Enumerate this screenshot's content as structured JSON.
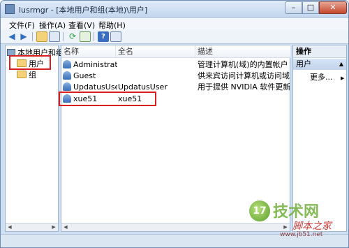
{
  "window": {
    "title": "lusrmgr - [本地用户和组(本地)\\用户]",
    "close_glyph": "✕",
    "maximize_glyph": "□",
    "minimize_glyph": "–"
  },
  "menu": [
    "文件(F)",
    "操作(A)",
    "查看(V)",
    "帮助(H)"
  ],
  "tree": {
    "root": "本地用户和组",
    "items": [
      "用户",
      "组"
    ]
  },
  "list": {
    "columns": [
      "名称",
      "全名",
      "描述"
    ],
    "rows": [
      {
        "name": "Administrat...",
        "fullname": "",
        "description": "管理计算机(域)的内置帐户"
      },
      {
        "name": "Guest",
        "fullname": "",
        "description": "供来宾访问计算机或访问域的内..."
      },
      {
        "name": "UpdatusUser",
        "fullname": "UpdatusUser",
        "description": "用于提供 NVIDIA 软件更新"
      },
      {
        "name": "xue51",
        "fullname": "xue51",
        "description": ""
      }
    ]
  },
  "actions": {
    "header": "操作",
    "section": "用户",
    "more": "更多..."
  },
  "watermark": {
    "logo": "17",
    "title": "技术网",
    "subtitle": "脚本之家",
    "url": "www.jb51.net"
  },
  "colors": {
    "highlight": "#d81e1e",
    "selection": "#cfe0f5"
  },
  "icons": [
    "back-arrow-icon",
    "forward-arrow-icon",
    "up-folder-icon",
    "show-tree-icon",
    "refresh-icon",
    "export-icon",
    "help-icon",
    "properties-icon"
  ]
}
